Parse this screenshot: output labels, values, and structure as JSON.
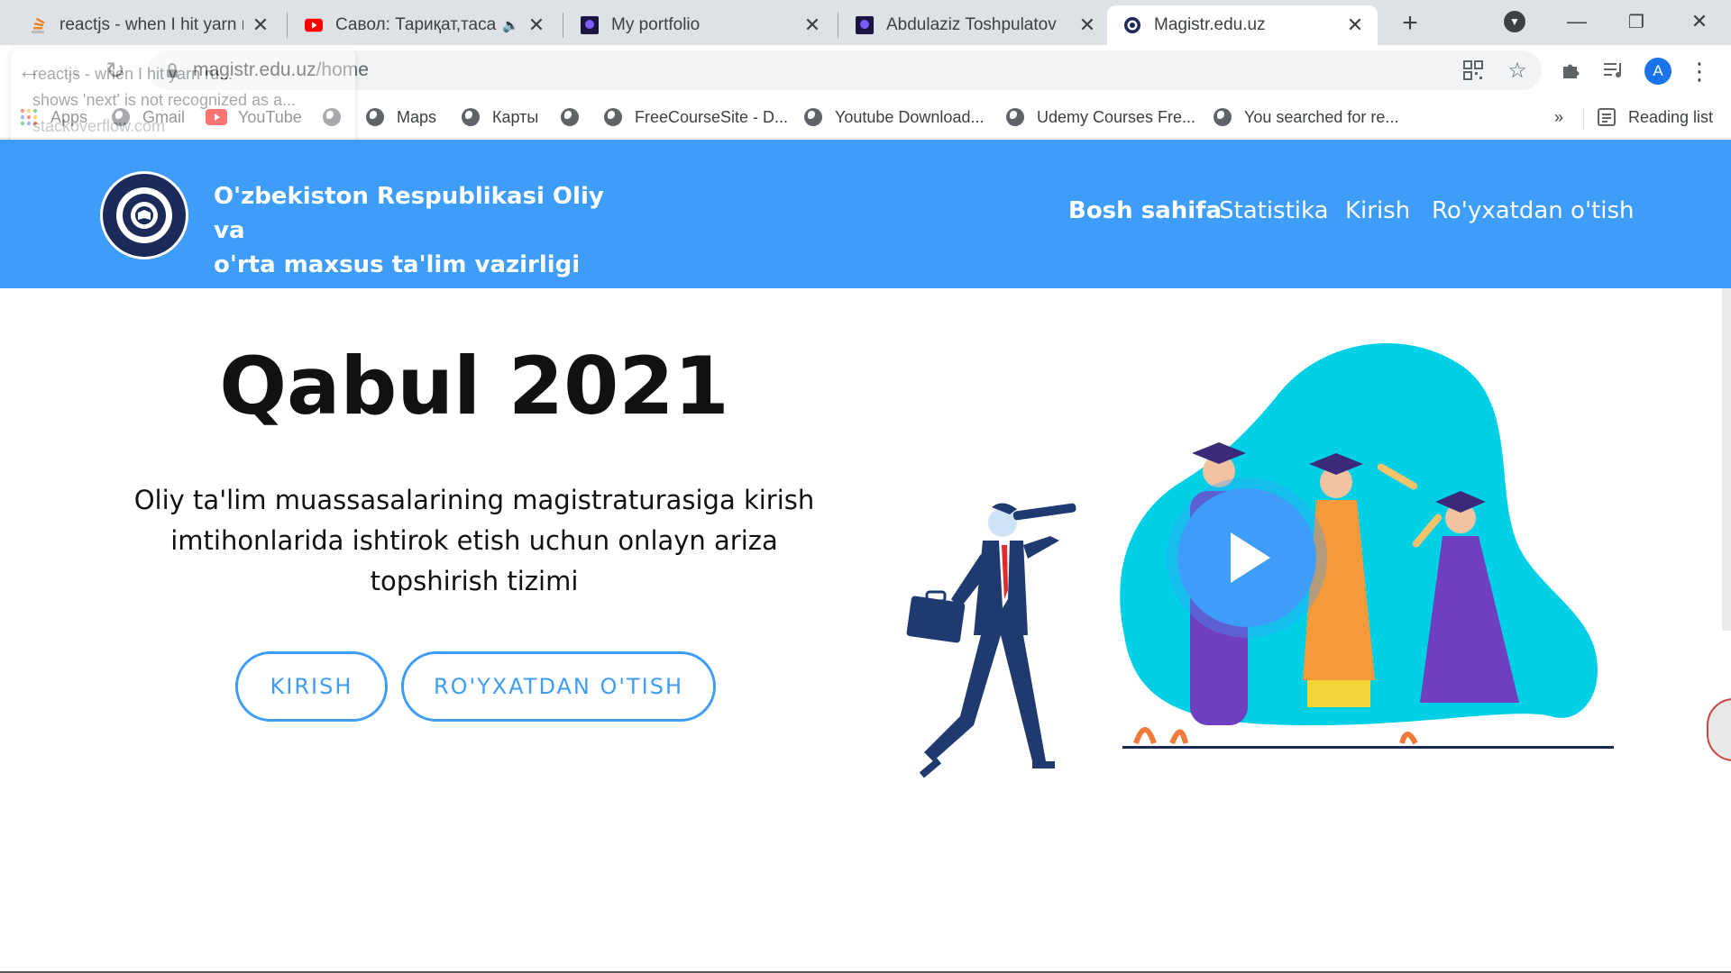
{
  "browser": {
    "tabs": [
      {
        "title": "reactjs - when I hit yarn run",
        "favicon": "stackoverflow-icon"
      },
      {
        "title": "Савол: Тариқат,тасаввуф",
        "favicon": "youtube-icon",
        "audio": true
      },
      {
        "title": "My portfolio",
        "favicon": "portfolio-icon"
      },
      {
        "title": "Abdulaziz Toshpulatov",
        "favicon": "portfolio-icon"
      },
      {
        "title": "Magistr.edu.uz",
        "favicon": "site-logo-icon",
        "active": true
      }
    ],
    "window_controls": {
      "minimize": "—",
      "restore": "❐",
      "close": "✕"
    },
    "address": {
      "host": "magistr.edu.uz",
      "path": "/home"
    },
    "profile_initial": "A",
    "bookmarks": [
      "Apps",
      "Gmail",
      "YouTube",
      "",
      "Maps",
      "Карты",
      "",
      "FreeCourseSite - D...",
      "Youtube Download...",
      "Udemy Courses Fre...",
      "You searched for re..."
    ],
    "bookmarks_more": "»",
    "reading_list": "Reading list",
    "hover_card": {
      "line1": "reactjs - when I hit yarn ru...",
      "line2": "shows 'next' is not recognized as a...",
      "host": "stackoverflow.com"
    }
  },
  "site": {
    "ministry_line1": "O'zbekiston Respublikasi Oliy va",
    "ministry_line2": "o'rta maxsus ta'lim vazirligi",
    "nav": [
      "Bosh sahifa",
      "Statistika",
      "Kirish",
      "Ro'yxatdan o'tish"
    ],
    "hero_title": "Qabul 2021",
    "hero_subtitle": "Oliy ta'lim muassasalarining magistraturasiga kirish imtihonlarida ishtirok etish uchun onlayn ariza topshirish tizimi",
    "btn_login": "KIRISH",
    "btn_register": "RO'YXATDAN O'TISH"
  },
  "colors": {
    "brand_blue": "#3d9df8",
    "blob": "#00d0e6",
    "suit": "#1f3a6e"
  }
}
